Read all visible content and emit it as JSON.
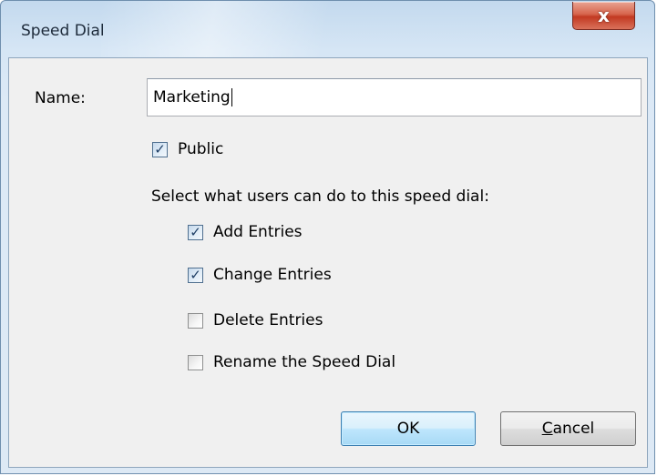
{
  "window": {
    "title": "Speed Dial",
    "close_glyph": "x"
  },
  "form": {
    "name_label": "Name:",
    "name_value": "Marketing",
    "public": {
      "label": "Public",
      "checked": true
    },
    "instruction": "Select what users can do to this speed dial:",
    "permissions": [
      {
        "label": "Add Entries",
        "checked": true
      },
      {
        "label": "Change Entries",
        "checked": true
      },
      {
        "label": "Delete Entries",
        "checked": false
      },
      {
        "label": "Rename the Speed Dial",
        "checked": false
      }
    ]
  },
  "buttons": {
    "ok_label": "OK",
    "cancel_mnemonic": "C",
    "cancel_rest": "ancel"
  },
  "icons": {
    "check": "checkmark-icon",
    "close": "close-icon"
  },
  "colors": {
    "title_bar": "#c3d9ee",
    "close_button": "#c23a22",
    "default_button_border": "#3c7fb1",
    "dialog_background": "#f0f0f0"
  }
}
